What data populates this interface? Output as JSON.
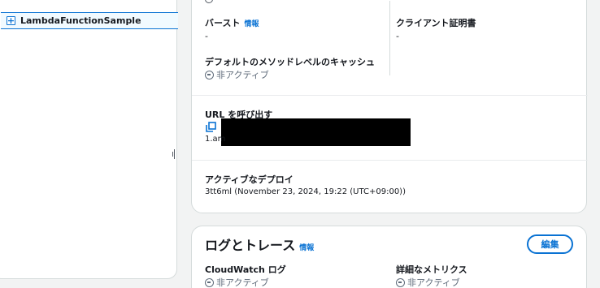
{
  "nav": {
    "selected_item": "LambdaFunctionSample",
    "expand_symbol": "+"
  },
  "stage_details": {
    "burst_label": "バースト",
    "burst_info": "情報",
    "burst_value": "-",
    "client_cert_label": "クライアント証明書",
    "client_cert_value": "-",
    "cache_label": "デフォルトのメソッドレベルのキャッシュ",
    "cache_status": "非アクティブ",
    "invoke_url_label": "URL を呼び出す",
    "invoke_url_fragment": "1.am",
    "active_deploy_label": "アクティブなデプロイ",
    "active_deploy_value": "3tt6ml (November 23, 2024, 19:22 (UTC+09:00))"
  },
  "logs_section": {
    "title": "ログとトレース",
    "info": "情報",
    "edit_label": "編集",
    "cloudwatch_label": "CloudWatch ログ",
    "cloudwatch_status": "非アクティブ",
    "detailed_metrics_label": "詳細なメトリクス",
    "detailed_metrics_status": "非アクティブ"
  },
  "colors": {
    "link": "#0972d3",
    "text": "#16191f",
    "muted": "#5f6b7a",
    "background": "#f2f3f3"
  },
  "icons": [
    "expand-icon",
    "copy-icon",
    "inactive-status-icon",
    "resize-handle-icon"
  ]
}
